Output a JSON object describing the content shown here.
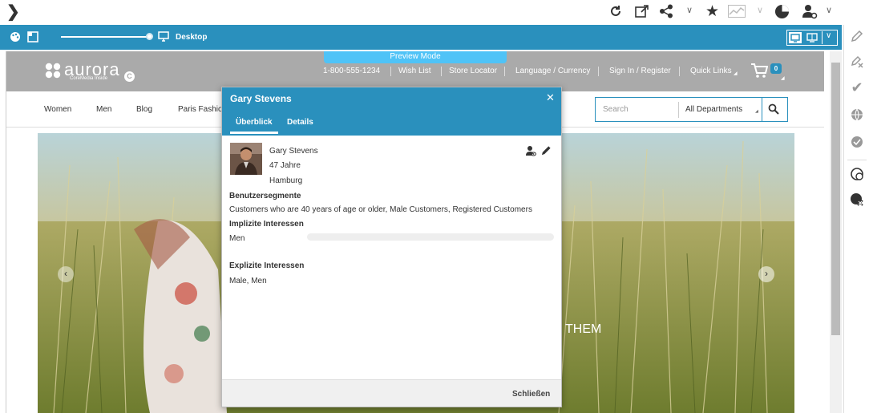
{
  "toolbar": {
    "back_icon": "chevron-right-icon",
    "icons": [
      "refresh-icon",
      "external-link-icon",
      "share-icon",
      "star-icon",
      "analytics-icon",
      "pie-chart-icon",
      "user-settings-icon"
    ]
  },
  "bluebar": {
    "device_label": "Desktop",
    "device_icon": "monitor-icon"
  },
  "site": {
    "logo_text": "aurora",
    "logo_sub": "CoreMedia Inside",
    "preview_mode": "Preview Mode",
    "phone": "1-800-555-1234",
    "wish_list": "Wish List",
    "store_locator": "Store Locator",
    "language_currency": "Language / Currency",
    "sign_in": "Sign In / Register",
    "quick_links": "Quick Links",
    "cart_count": "0",
    "menu": [
      "Women",
      "Men",
      "Blog",
      "Paris Fashio"
    ],
    "search_placeholder": "Search",
    "department": "All Departments",
    "hero_text": "THEM"
  },
  "dialog": {
    "title": "Gary Stevens",
    "tabs": [
      "Überblick",
      "Details"
    ],
    "name": "Gary Stevens",
    "age": "47 Jahre",
    "city": "Hamburg",
    "segments_heading": "Benutzersegmente",
    "segments": "Customers who are 40 years of age or older, Male Customers, Registered Customers",
    "implicit_heading": "Implizite Interessen",
    "implicit_item": "Men",
    "explicit_heading": "Explizite Interessen",
    "explicit_value": "Male, Men",
    "close_button": "Schließen"
  },
  "colors": {
    "accent": "#2a90bd",
    "preview_badge": "#4fc3f7",
    "site_header": "#aaaaaa"
  }
}
